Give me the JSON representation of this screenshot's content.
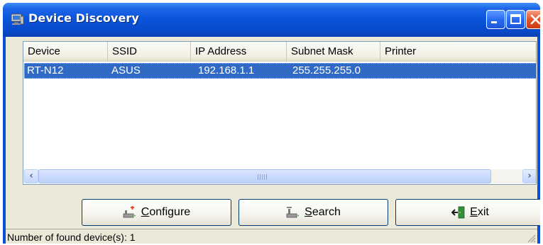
{
  "window": {
    "title": "Device Discovery"
  },
  "list": {
    "columns": [
      "Device",
      "SSID",
      "IP Address",
      "Subnet Mask",
      "Printer"
    ],
    "rows": [
      {
        "device": "RT-N12",
        "ssid": "ASUS",
        "ip": "192.168.1.1",
        "mask": "255.255.255.0",
        "printer": ""
      }
    ],
    "selected_row": 0
  },
  "buttons": {
    "configure": {
      "mnemonic": "C",
      "rest": "onfigure",
      "icon": "configure-icon"
    },
    "search": {
      "mnemonic": "S",
      "rest": "earch",
      "icon": "search-icon"
    },
    "exit": {
      "mnemonic": "E",
      "rest": "xit",
      "icon": "exit-icon"
    }
  },
  "status": {
    "text": "Number of found device(s): 1"
  },
  "colors": {
    "selection": "#316ac5",
    "titlebar": "#0a53d9",
    "close": "#e2552c"
  }
}
